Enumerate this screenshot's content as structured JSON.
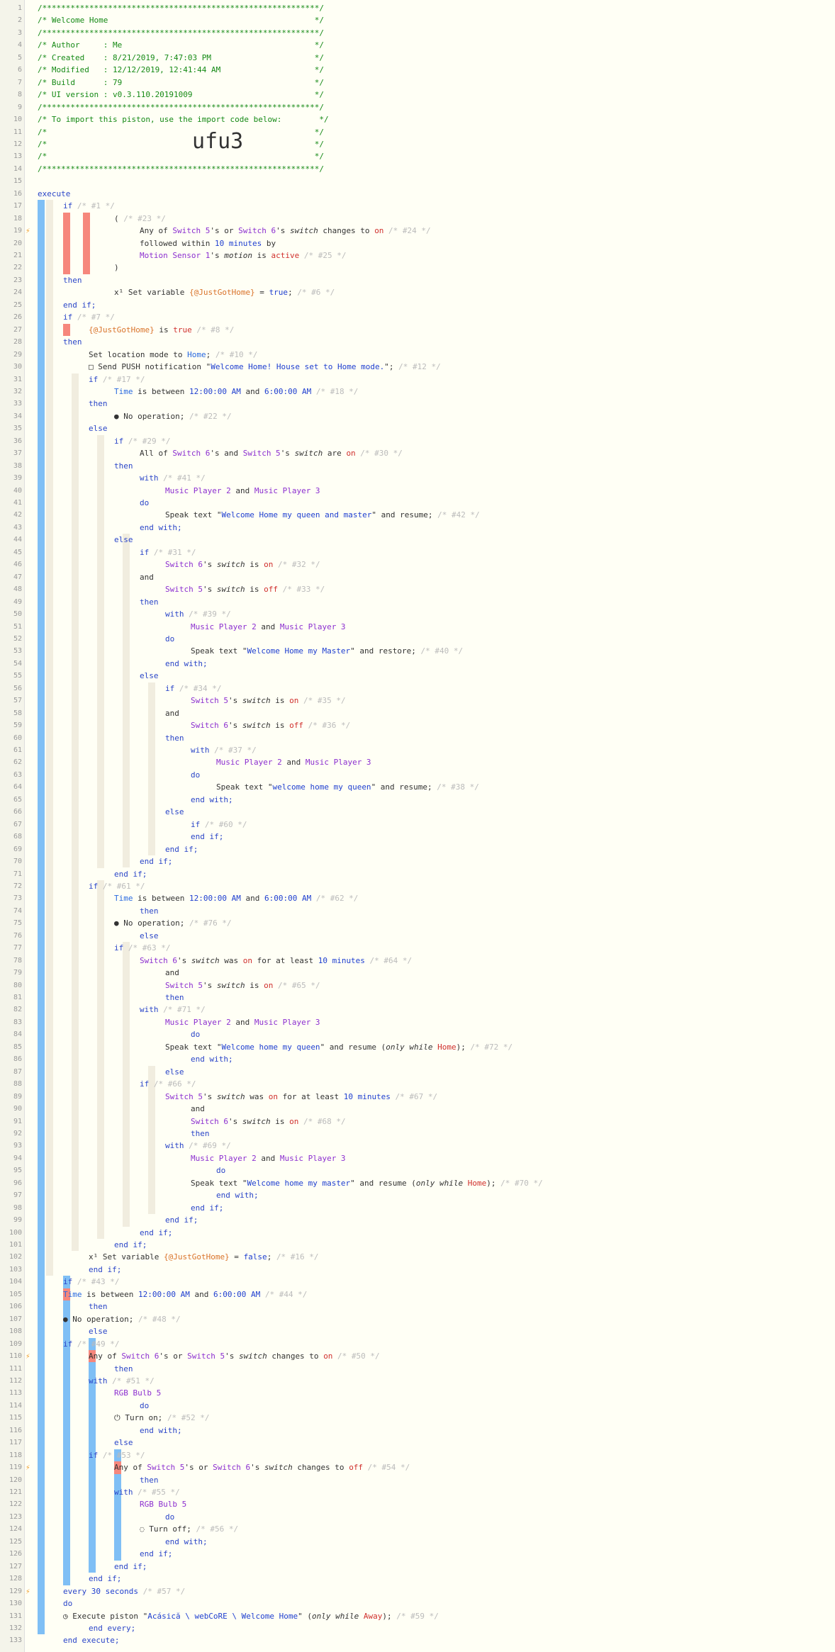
{
  "piston": {
    "header": [
      "/***********************************************************/",
      "/* Welcome Home                                            */",
      "/***********************************************************/",
      "/* Author     : Me                                         */",
      "/* Created    : 8/21/2019, 7:47:03 PM                      */",
      "/* Modified   : 12/12/2019, 12:41:44 AM                    */",
      "/* Build      : 79                                         */",
      "/* UI version : v0.3.110.20191009                          */",
      "/***********************************************************/",
      "/* To import this piston, use the import code below:        */",
      "/*                                                         */",
      "/*                                                         */",
      "/*                                                         */",
      "/***********************************************************/"
    ],
    "import_code": "ufu3",
    "line_count": 133
  },
  "lines": [
    [],
    [],
    [],
    [],
    [],
    [],
    [],
    [],
    [],
    [],
    [],
    [],
    [],
    [],
    [],
    [
      [
        "execute",
        "k"
      ]
    ],
    [
      [
        "if ",
        "k"
      ],
      [
        "/* #1 */",
        "c"
      ]
    ],
    [
      [
        "( ",
        "t"
      ],
      [
        "/* #23 */",
        "c"
      ]
    ],
    [
      [
        "Any of ",
        "t"
      ],
      [
        "Switch 5",
        "d"
      ],
      [
        "'s or ",
        "t"
      ],
      [
        "Switch 6",
        "d"
      ],
      [
        "'s ",
        "t"
      ],
      [
        "switch",
        "it"
      ],
      [
        " changes to ",
        "t"
      ],
      [
        "on",
        "r"
      ],
      [
        " /* #24 */",
        "c"
      ]
    ],
    [
      [
        "followed within ",
        "t"
      ],
      [
        "10 minutes",
        "s"
      ],
      [
        " by",
        "t"
      ]
    ],
    [
      [
        "Motion Sensor 1",
        "d"
      ],
      [
        "'s ",
        "t"
      ],
      [
        "motion",
        "it"
      ],
      [
        " is ",
        "t"
      ],
      [
        "active",
        "r"
      ],
      [
        " /* #25 */",
        "c"
      ]
    ],
    [
      [
        ")",
        "t"
      ]
    ],
    [
      [
        "then",
        "k"
      ]
    ],
    [
      [
        "x¹ ",
        "t"
      ],
      [
        "Set variable ",
        "t"
      ],
      [
        "{@JustGotHome}",
        "o"
      ],
      [
        " = ",
        "t"
      ],
      [
        "true",
        "s"
      ],
      [
        "; ",
        "t"
      ],
      [
        "/* #6 */",
        "c"
      ]
    ],
    [
      [
        "end if;",
        "k"
      ]
    ],
    [
      [
        "if ",
        "k"
      ],
      [
        "/* #7 */",
        "c"
      ]
    ],
    [
      [
        "{@JustGotHome}",
        "o"
      ],
      [
        " is ",
        "t"
      ],
      [
        "true",
        "r"
      ],
      [
        " /* #8 */",
        "c"
      ]
    ],
    [
      [
        "then",
        "k"
      ]
    ],
    [
      [
        "Set location mode to ",
        "t"
      ],
      [
        "Home",
        "v"
      ],
      [
        "; ",
        "t"
      ],
      [
        "/* #10 */",
        "c"
      ]
    ],
    [
      [
        "□ ",
        "t"
      ],
      [
        "Send PUSH notification \"",
        "t"
      ],
      [
        "Welcome Home! House set to Home mode.",
        "s"
      ],
      [
        "\"; ",
        "t"
      ],
      [
        "/* #12 */",
        "c"
      ]
    ],
    [
      [
        "if ",
        "k"
      ],
      [
        "/* #17 */",
        "c"
      ]
    ],
    [
      [
        "Time",
        "v"
      ],
      [
        " is between ",
        "t"
      ],
      [
        "12:00:00 AM",
        "s"
      ],
      [
        " and ",
        "t"
      ],
      [
        "6:00:00 AM",
        "s"
      ],
      [
        " /* #18 */",
        "c"
      ]
    ],
    [
      [
        "then",
        "k"
      ]
    ],
    [
      [
        "● ",
        "t"
      ],
      [
        "No operation; ",
        "t"
      ],
      [
        "/* #22 */",
        "c"
      ]
    ],
    [
      [
        "else",
        "k"
      ]
    ],
    [
      [
        "if ",
        "k"
      ],
      [
        "/* #29 */",
        "c"
      ]
    ],
    [
      [
        "All of ",
        "t"
      ],
      [
        "Switch 6",
        "d"
      ],
      [
        "'s and ",
        "t"
      ],
      [
        "Switch 5",
        "d"
      ],
      [
        "'s ",
        "t"
      ],
      [
        "switch",
        "it"
      ],
      [
        " are ",
        "t"
      ],
      [
        "on",
        "r"
      ],
      [
        " /* #30 */",
        "c"
      ]
    ],
    [
      [
        "then",
        "k"
      ]
    ],
    [
      [
        "with ",
        "k"
      ],
      [
        "/* #41 */",
        "c"
      ]
    ],
    [
      [
        "Music Player 2",
        "d"
      ],
      [
        " and ",
        "t"
      ],
      [
        "Music Player 3",
        "d"
      ]
    ],
    [
      [
        "do",
        "k"
      ]
    ],
    [
      [
        "Speak text \"",
        "t"
      ],
      [
        "Welcome Home my queen and master",
        "s"
      ],
      [
        "\" and resume; ",
        "t"
      ],
      [
        "/* #42 */",
        "c"
      ]
    ],
    [
      [
        "end with;",
        "k"
      ]
    ],
    [
      [
        "else",
        "k"
      ]
    ],
    [
      [
        "if ",
        "k"
      ],
      [
        "/* #31 */",
        "c"
      ]
    ],
    [
      [
        "Switch 6",
        "d"
      ],
      [
        "'s ",
        "t"
      ],
      [
        "switch",
        "it"
      ],
      [
        " is ",
        "t"
      ],
      [
        "on",
        "r"
      ],
      [
        " /* #32 */",
        "c"
      ]
    ],
    [
      [
        "and",
        "t"
      ]
    ],
    [
      [
        "Switch 5",
        "d"
      ],
      [
        "'s ",
        "t"
      ],
      [
        "switch",
        "it"
      ],
      [
        " is ",
        "t"
      ],
      [
        "off",
        "r"
      ],
      [
        " /* #33 */",
        "c"
      ]
    ],
    [
      [
        "then",
        "k"
      ]
    ],
    [
      [
        "with ",
        "k"
      ],
      [
        "/* #39 */",
        "c"
      ]
    ],
    [
      [
        "Music Player 2",
        "d"
      ],
      [
        " and ",
        "t"
      ],
      [
        "Music Player 3",
        "d"
      ]
    ],
    [
      [
        "do",
        "k"
      ]
    ],
    [
      [
        "Speak text \"",
        "t"
      ],
      [
        "Welcome Home my Master",
        "s"
      ],
      [
        "\" and restore; ",
        "t"
      ],
      [
        "/* #40 */",
        "c"
      ]
    ],
    [
      [
        "end with;",
        "k"
      ]
    ],
    [
      [
        "else",
        "k"
      ]
    ],
    [
      [
        "if ",
        "k"
      ],
      [
        "/* #34 */",
        "c"
      ]
    ],
    [
      [
        "Switch 5",
        "d"
      ],
      [
        "'s ",
        "t"
      ],
      [
        "switch",
        "it"
      ],
      [
        " is ",
        "t"
      ],
      [
        "on",
        "r"
      ],
      [
        " /* #35 */",
        "c"
      ]
    ],
    [
      [
        "and",
        "t"
      ]
    ],
    [
      [
        "Switch 6",
        "d"
      ],
      [
        "'s ",
        "t"
      ],
      [
        "switch",
        "it"
      ],
      [
        " is ",
        "t"
      ],
      [
        "off",
        "r"
      ],
      [
        " /* #36 */",
        "c"
      ]
    ],
    [
      [
        "then",
        "k"
      ]
    ],
    [
      [
        "with ",
        "k"
      ],
      [
        "/* #37 */",
        "c"
      ]
    ],
    [
      [
        "Music Player 2",
        "d"
      ],
      [
        " and ",
        "t"
      ],
      [
        "Music Player 3",
        "d"
      ]
    ],
    [
      [
        "do",
        "k"
      ]
    ],
    [
      [
        "Speak text \"",
        "t"
      ],
      [
        "welcome home my queen",
        "s"
      ],
      [
        "\" and resume; ",
        "t"
      ],
      [
        "/* #38 */",
        "c"
      ]
    ],
    [
      [
        "end with;",
        "k"
      ]
    ],
    [
      [
        "else",
        "k"
      ]
    ],
    [
      [
        "if ",
        "k"
      ],
      [
        "/* #60 */",
        "c"
      ]
    ],
    [
      [
        "end if;",
        "k"
      ]
    ],
    [
      [
        "end if;",
        "k"
      ]
    ],
    [
      [
        "end if;",
        "k"
      ]
    ],
    [
      [
        "end if;",
        "k"
      ]
    ],
    [
      [
        "if ",
        "k"
      ],
      [
        "/* #61 */",
        "c"
      ]
    ],
    [
      [
        "Time",
        "v"
      ],
      [
        " is between ",
        "t"
      ],
      [
        "12:00:00 AM",
        "s"
      ],
      [
        " and ",
        "t"
      ],
      [
        "6:00:00 AM",
        "s"
      ],
      [
        " /* #62 */",
        "c"
      ]
    ],
    [
      [
        "then",
        "k"
      ]
    ],
    [
      [
        "● ",
        "t"
      ],
      [
        "No operation; ",
        "t"
      ],
      [
        "/* #76 */",
        "c"
      ]
    ],
    [
      [
        "else",
        "k"
      ]
    ],
    [
      [
        "if ",
        "k"
      ],
      [
        "/* #63 */",
        "c"
      ]
    ],
    [
      [
        "Switch 6",
        "d"
      ],
      [
        "'s ",
        "t"
      ],
      [
        "switch",
        "it"
      ],
      [
        " was ",
        "t"
      ],
      [
        "on",
        "r"
      ],
      [
        " for at least ",
        "t"
      ],
      [
        "10 minutes",
        "s"
      ],
      [
        " /* #64 */",
        "c"
      ]
    ],
    [
      [
        "and",
        "t"
      ]
    ],
    [
      [
        "Switch 5",
        "d"
      ],
      [
        "'s ",
        "t"
      ],
      [
        "switch",
        "it"
      ],
      [
        " is ",
        "t"
      ],
      [
        "on",
        "r"
      ],
      [
        " /* #65 */",
        "c"
      ]
    ],
    [
      [
        "then",
        "k"
      ]
    ],
    [
      [
        "with ",
        "k"
      ],
      [
        "/* #71 */",
        "c"
      ]
    ],
    [
      [
        "Music Player 2",
        "d"
      ],
      [
        " and ",
        "t"
      ],
      [
        "Music Player 3",
        "d"
      ]
    ],
    [
      [
        "do",
        "k"
      ]
    ],
    [
      [
        "Speak text \"",
        "t"
      ],
      [
        "Welcome home my queen",
        "s"
      ],
      [
        "\" and resume (",
        "t"
      ],
      [
        "only while ",
        "it"
      ],
      [
        "Home",
        "r"
      ],
      [
        "); ",
        "t"
      ],
      [
        "/* #72 */",
        "c"
      ]
    ],
    [
      [
        "end with;",
        "k"
      ]
    ],
    [
      [
        "else",
        "k"
      ]
    ],
    [
      [
        "if ",
        "k"
      ],
      [
        "/* #66 */",
        "c"
      ]
    ],
    [
      [
        "Switch 5",
        "d"
      ],
      [
        "'s ",
        "t"
      ],
      [
        "switch",
        "it"
      ],
      [
        " was ",
        "t"
      ],
      [
        "on",
        "r"
      ],
      [
        " for at least ",
        "t"
      ],
      [
        "10 minutes",
        "s"
      ],
      [
        " /* #67 */",
        "c"
      ]
    ],
    [
      [
        "and",
        "t"
      ]
    ],
    [
      [
        "Switch 6",
        "d"
      ],
      [
        "'s ",
        "t"
      ],
      [
        "switch",
        "it"
      ],
      [
        " is ",
        "t"
      ],
      [
        "on",
        "r"
      ],
      [
        " /* #68 */",
        "c"
      ]
    ],
    [
      [
        "then",
        "k"
      ]
    ],
    [
      [
        "with ",
        "k"
      ],
      [
        "/* #69 */",
        "c"
      ]
    ],
    [
      [
        "Music Player 2",
        "d"
      ],
      [
        " and ",
        "t"
      ],
      [
        "Music Player 3",
        "d"
      ]
    ],
    [
      [
        "do",
        "k"
      ]
    ],
    [
      [
        "Speak text \"",
        "t"
      ],
      [
        "Welcome home my master",
        "s"
      ],
      [
        "\" and resume (",
        "t"
      ],
      [
        "only while ",
        "it"
      ],
      [
        "Home",
        "r"
      ],
      [
        "); ",
        "t"
      ],
      [
        "/* #70 */",
        "c"
      ]
    ],
    [
      [
        "end with;",
        "k"
      ]
    ],
    [
      [
        "end if;",
        "k"
      ]
    ],
    [
      [
        "end if;",
        "k"
      ]
    ],
    [
      [
        "end if;",
        "k"
      ]
    ],
    [
      [
        "end if;",
        "k"
      ]
    ],
    [
      [
        "x¹ ",
        "t"
      ],
      [
        "Set variable ",
        "t"
      ],
      [
        "{@JustGotHome}",
        "o"
      ],
      [
        " = ",
        "t"
      ],
      [
        "false",
        "s"
      ],
      [
        "; ",
        "t"
      ],
      [
        "/* #16 */",
        "c"
      ]
    ],
    [
      [
        "end if;",
        "k"
      ]
    ],
    [
      [
        "if ",
        "k"
      ],
      [
        "/* #43 */",
        "c"
      ]
    ],
    [
      [
        "Time",
        "v"
      ],
      [
        " is between ",
        "t"
      ],
      [
        "12:00:00 AM",
        "s"
      ],
      [
        " and ",
        "t"
      ],
      [
        "6:00:00 AM",
        "s"
      ],
      [
        " /* #44 */",
        "c"
      ]
    ],
    [
      [
        "then",
        "k"
      ]
    ],
    [
      [
        "● ",
        "t"
      ],
      [
        "No operation; ",
        "t"
      ],
      [
        "/* #48 */",
        "c"
      ]
    ],
    [
      [
        "else",
        "k"
      ]
    ],
    [
      [
        "if ",
        "k"
      ],
      [
        "/* #49 */",
        "c"
      ]
    ],
    [
      [
        "Any of ",
        "t"
      ],
      [
        "Switch 6",
        "d"
      ],
      [
        "'s or ",
        "t"
      ],
      [
        "Switch 5",
        "d"
      ],
      [
        "'s ",
        "t"
      ],
      [
        "switch",
        "it"
      ],
      [
        " changes to ",
        "t"
      ],
      [
        "on",
        "r"
      ],
      [
        " /* #50 */",
        "c"
      ]
    ],
    [
      [
        "then",
        "k"
      ]
    ],
    [
      [
        "with ",
        "k"
      ],
      [
        "/* #51 */",
        "c"
      ]
    ],
    [
      [
        "RGB Bulb 5",
        "d"
      ]
    ],
    [
      [
        "do",
        "k"
      ]
    ],
    [
      [
        "⏻ ",
        "t"
      ],
      [
        "Turn on; ",
        "t"
      ],
      [
        "/* #52 */",
        "c"
      ]
    ],
    [
      [
        "end with;",
        "k"
      ]
    ],
    [
      [
        "else",
        "k"
      ]
    ],
    [
      [
        "if ",
        "k"
      ],
      [
        "/* #53 */",
        "c"
      ]
    ],
    [
      [
        "Any of ",
        "t"
      ],
      [
        "Switch 5",
        "d"
      ],
      [
        "'s or ",
        "t"
      ],
      [
        "Switch 6",
        "d"
      ],
      [
        "'s ",
        "t"
      ],
      [
        "switch",
        "it"
      ],
      [
        " changes to ",
        "t"
      ],
      [
        "off",
        "r"
      ],
      [
        " /* #54 */",
        "c"
      ]
    ],
    [
      [
        "then",
        "k"
      ]
    ],
    [
      [
        "with ",
        "k"
      ],
      [
        "/* #55 */",
        "c"
      ]
    ],
    [
      [
        "RGB Bulb 5",
        "d"
      ]
    ],
    [
      [
        "do",
        "k"
      ]
    ],
    [
      [
        "◌ ",
        "t"
      ],
      [
        "Turn off; ",
        "t"
      ],
      [
        "/* #56 */",
        "c"
      ]
    ],
    [
      [
        "end with;",
        "k"
      ]
    ],
    [
      [
        "end if;",
        "k"
      ]
    ],
    [
      [
        "end if;",
        "k"
      ]
    ],
    [
      [
        "end if;",
        "k"
      ]
    ],
    [
      [
        "every ",
        "k"
      ],
      [
        "30 seconds",
        "s"
      ],
      [
        " /* #57 */",
        "c"
      ]
    ],
    [
      [
        "do",
        "k"
      ]
    ],
    [
      [
        "◷ ",
        "t"
      ],
      [
        "Execute piston \"",
        "t"
      ],
      [
        "Acásică \\ webCoRE \\ Welcome Home",
        "s"
      ],
      [
        "\" (",
        "t"
      ],
      [
        "only while ",
        "it"
      ],
      [
        "Away",
        "r"
      ],
      [
        "); ",
        "t"
      ],
      [
        "/* #59 */",
        "c"
      ]
    ],
    [
      [
        "end every;",
        "k"
      ]
    ],
    [
      [
        "end execute;",
        "k"
      ]
    ]
  ],
  "indent": [
    0,
    0,
    0,
    0,
    0,
    0,
    0,
    0,
    0,
    0,
    0,
    0,
    0,
    0,
    0,
    0,
    1,
    3,
    4,
    4,
    4,
    3,
    1,
    3,
    1,
    1,
    2,
    1,
    2,
    2,
    2,
    3,
    2,
    3,
    2,
    3,
    4,
    3,
    4,
    5,
    4,
    5,
    4,
    3,
    4,
    5,
    4,
    5,
    4,
    5,
    6,
    5,
    6,
    5,
    4,
    5,
    6,
    5,
    6,
    5,
    6,
    7,
    6,
    7,
    6,
    5,
    6,
    6,
    5,
    4,
    3,
    2,
    3,
    4,
    3,
    4,
    3,
    4,
    5,
    5,
    5,
    4,
    5,
    6,
    5,
    6,
    5,
    4,
    5,
    6,
    6,
    6,
    5,
    6,
    7,
    6,
    7,
    6,
    5,
    4,
    3,
    2,
    2,
    1,
    1,
    2,
    1,
    2,
    1,
    2,
    3,
    2,
    3,
    4,
    3,
    4,
    3,
    2,
    3,
    4,
    3,
    4,
    5,
    4,
    5,
    4,
    3,
    2,
    1,
    1,
    1,
    2,
    1,
    0
  ],
  "flash_lines": [
    19,
    110,
    119,
    129
  ]
}
